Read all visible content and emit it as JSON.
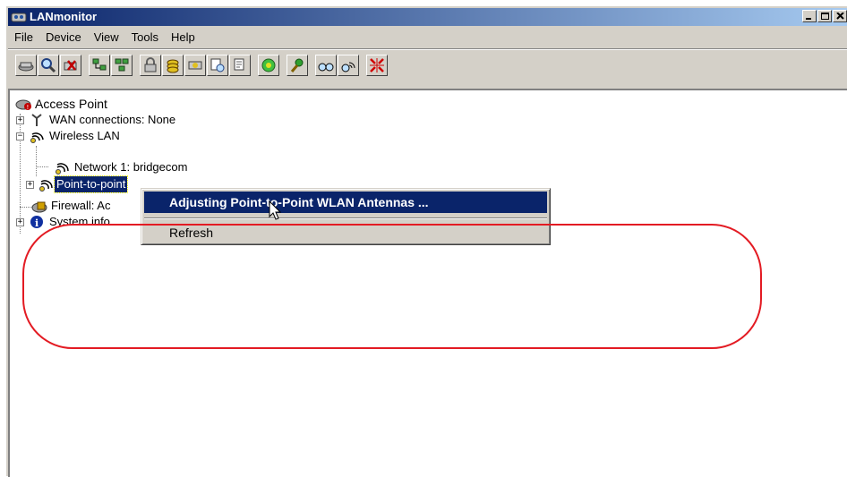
{
  "window": {
    "title": "LANmonitor"
  },
  "menubar": {
    "items": [
      "File",
      "Device",
      "View",
      "Tools",
      "Help"
    ]
  },
  "tree": {
    "root": "Access Point",
    "wan": "WAN connections: None",
    "wireless_lan": "Wireless LAN",
    "network1": "Network 1: bridgecom",
    "point_to_point": "Point-to-point",
    "firewall": "Firewall: Ac",
    "system_info": "System info"
  },
  "context_menu": {
    "items": [
      "Adjusting Point-to-Point WLAN Antennas ...",
      "Refresh"
    ]
  },
  "colors": {
    "selection": "#0a246a",
    "annotation": "#e31b23",
    "titlebar": "#0a246a"
  }
}
